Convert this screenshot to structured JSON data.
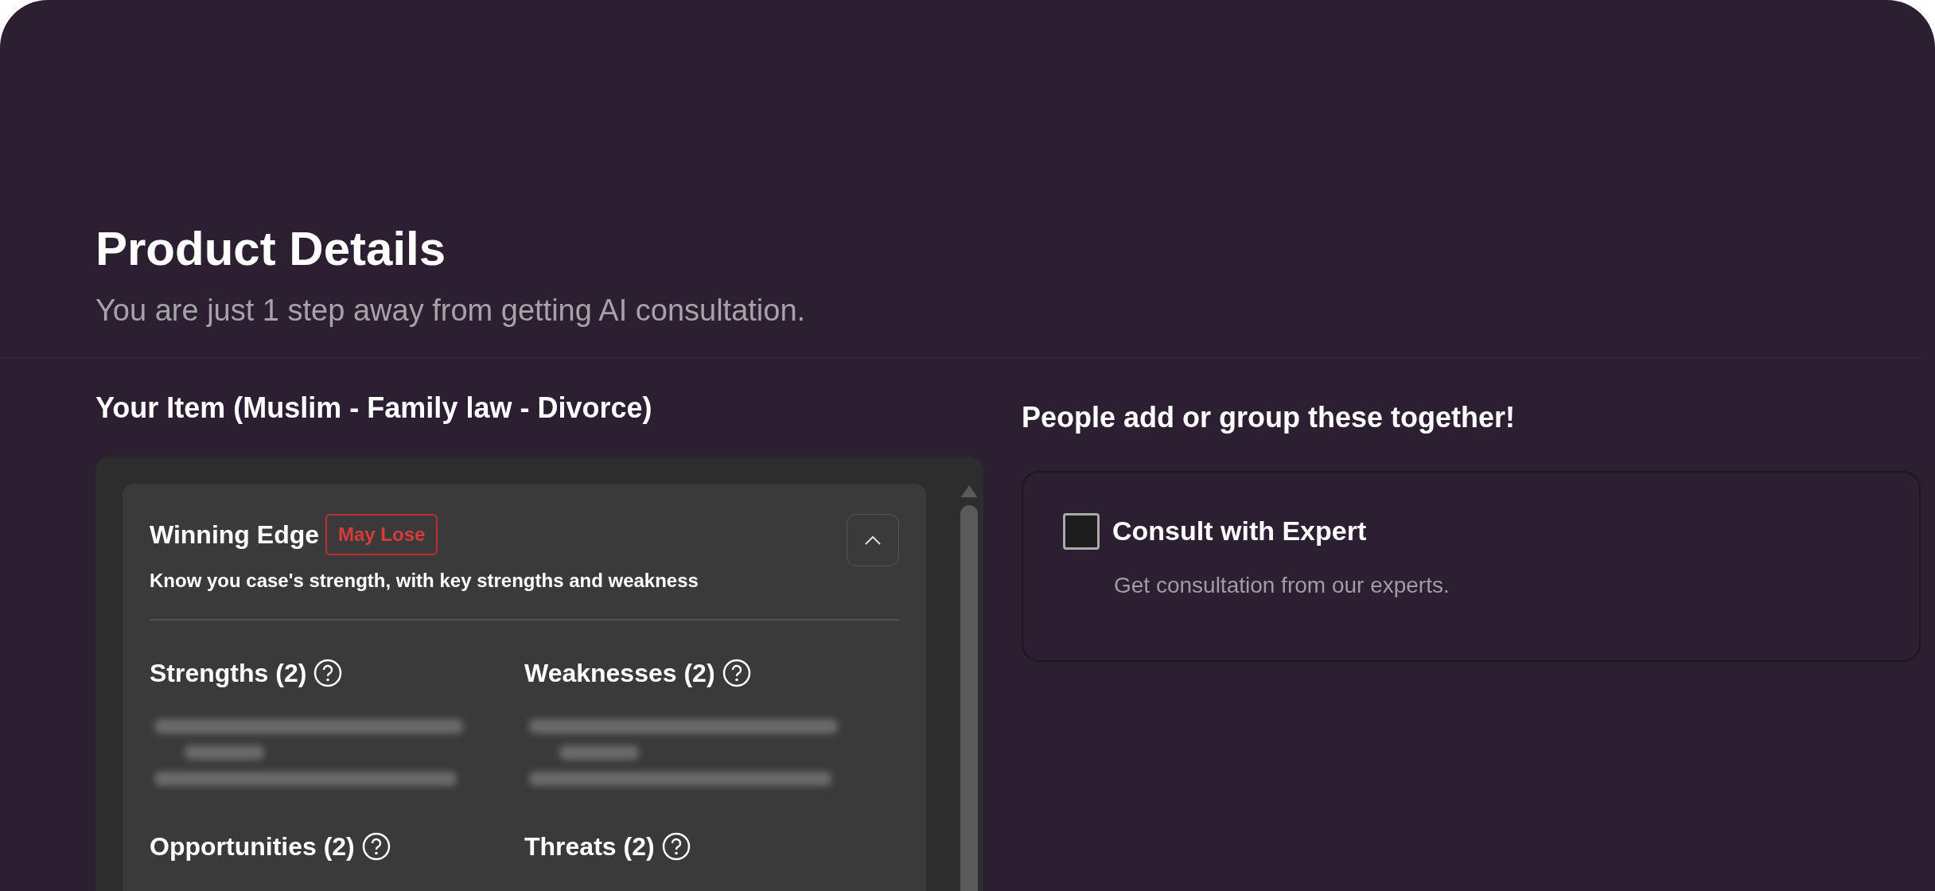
{
  "header": {
    "title": "Product Details",
    "subtitle": "You are just 1 step away from getting AI consultation."
  },
  "item": {
    "heading": "Your Item (Muslim - Family law - Divorce)",
    "card": {
      "title": "Winning Edge",
      "badge": "May Lose",
      "description": "Know you case's strength, with key strengths and weakness",
      "expanded": true,
      "sections": [
        {
          "title": "Strengths (2)",
          "blurred_list": true
        },
        {
          "title": "Weaknesses (2)",
          "blurred_list": true
        },
        {
          "title": "Opportunities (2)",
          "blurred_list": false
        },
        {
          "title": "Threats (2)",
          "blurred_list": false
        }
      ]
    }
  },
  "addons": {
    "heading": "People add or group these together!",
    "items": [
      {
        "title": "Consult with Expert",
        "description": "Get consultation from our experts.",
        "checked": false
      }
    ]
  }
}
